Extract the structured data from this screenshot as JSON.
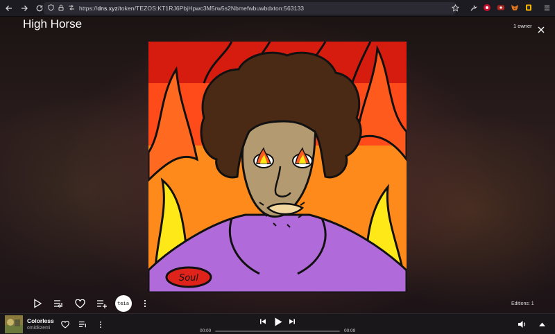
{
  "browser": {
    "url_prefix": "https://",
    "url_host": "dns.xyz",
    "url_path": "/token/TEZOS:KT1RJ6PbjHpwc3M5rw5s2Nbmefwbuwbdxton:563133"
  },
  "page": {
    "title": "High Horse",
    "owners": "1 owner",
    "editions": "Editions: 1",
    "artwork": {
      "badge_text": "Soul",
      "colors": {
        "red": "#d61c0f",
        "orange": "#ff5a1e",
        "yellow": "#ffe818",
        "purple": "#b06ad9",
        "skin": "#b49a70",
        "hair": "#4a2a14"
      }
    },
    "actions": {
      "teia_label": "teia"
    }
  },
  "player": {
    "track_title": "Colorless",
    "artist": "omidkzemi",
    "time_current": "00:00",
    "time_total": "00:09",
    "progress": 0
  }
}
